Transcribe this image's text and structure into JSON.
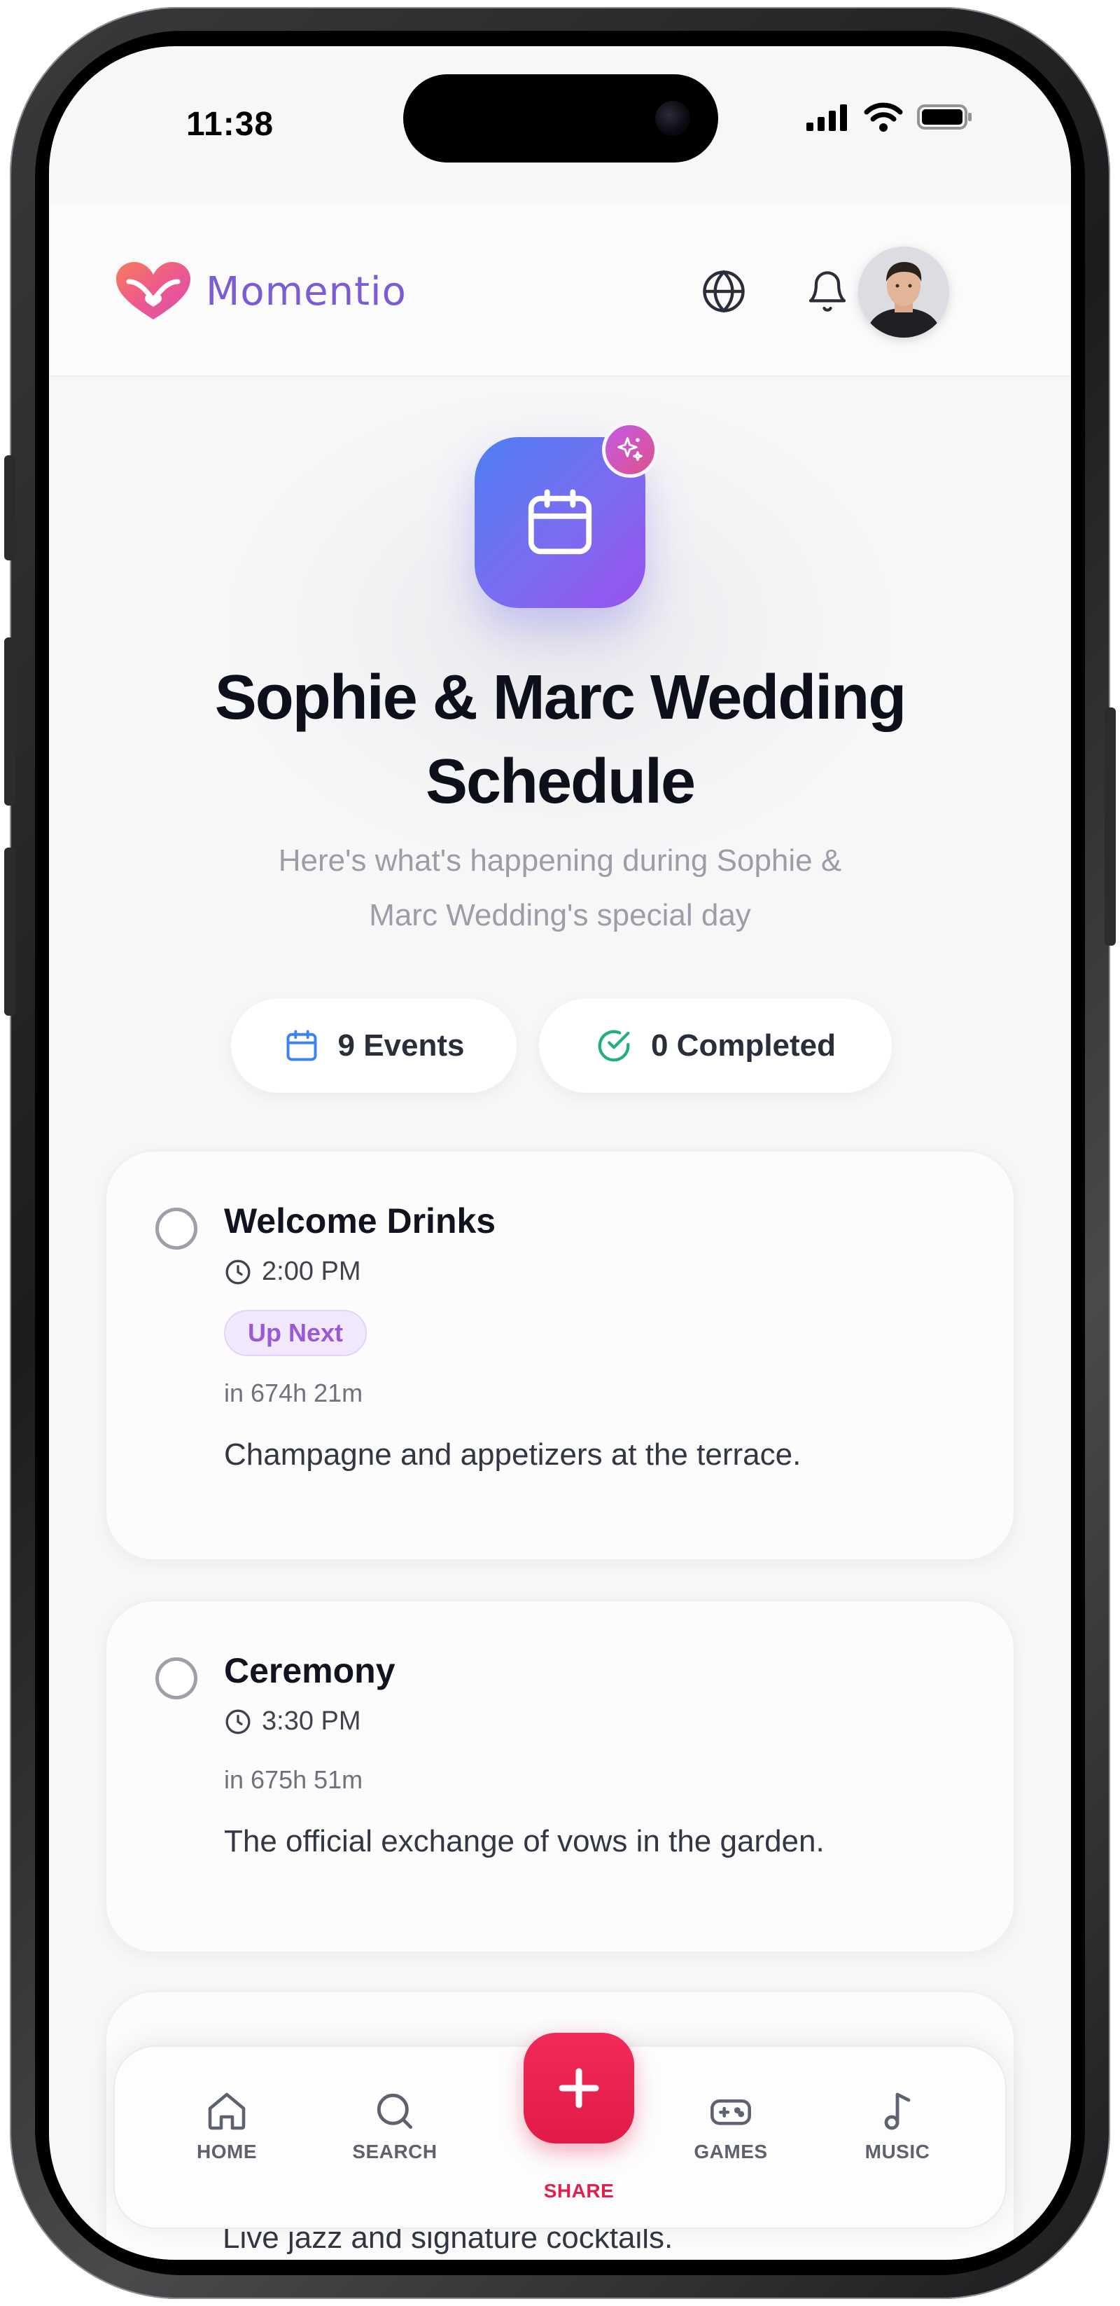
{
  "status_bar": {
    "time": "11:38"
  },
  "header": {
    "brand": "Momentio"
  },
  "hero": {
    "title": "Sophie & Marc Wedding Schedule",
    "subtitle": "Here's what's happening during Sophie & Marc Wedding's special day"
  },
  "stats": {
    "events": "9 Events",
    "completed": "0 Completed"
  },
  "events": [
    {
      "title": "Welcome Drinks",
      "time": "2:00 PM",
      "badge": "Up Next",
      "countdown": "in 674h 21m",
      "description": "Champagne and appetizers at the terrace."
    },
    {
      "title": "Ceremony",
      "time": "3:30 PM",
      "countdown": "in 675h 51m",
      "description": "The official exchange of vows in the garden."
    },
    {
      "description": "Live jazz and signature cocktails."
    }
  ],
  "nav": {
    "home": "HOME",
    "search": "SEARCH",
    "share": "SHARE",
    "games": "GAMES",
    "music": "MUSIC"
  },
  "colors": {
    "brand": "#7b5cd6",
    "accent_red": "#e01b47",
    "badge_purple": "#9a5ad8",
    "check_green": "#22b07d",
    "calendar_blue": "#3b82f6"
  },
  "icons": [
    "globe-icon",
    "bell-icon",
    "calendar-icon",
    "sparkle-icon",
    "check-circle-icon",
    "clock-icon",
    "home-icon",
    "search-icon",
    "plus-icon",
    "gamepad-icon",
    "music-note-icon"
  ]
}
